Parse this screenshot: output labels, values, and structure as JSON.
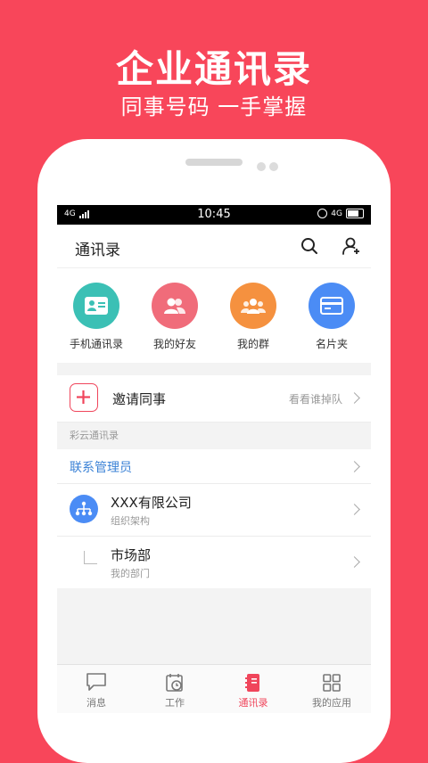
{
  "promo": {
    "title": "企业通讯录",
    "subtitle": "同事号码 一手掌握"
  },
  "status_bar": {
    "network_left": "4G",
    "time": "10:45",
    "network_right": "4G"
  },
  "header": {
    "title": "通讯录",
    "search_icon": "search-icon",
    "add_contact_icon": "add-person-icon"
  },
  "quick_actions": [
    {
      "label": "手机通讯录",
      "icon": "contact-card-icon",
      "color": "#3bc0b5"
    },
    {
      "label": "我的好友",
      "icon": "friends-icon",
      "color": "#f06c7a"
    },
    {
      "label": "我的群",
      "icon": "group-icon",
      "color": "#f5913f"
    },
    {
      "label": "名片夹",
      "icon": "business-card-icon",
      "color": "#4b8cf5"
    }
  ],
  "invite": {
    "label": "邀请同事",
    "hint": "看看谁掉队",
    "icon": "plus-icon",
    "accent": "#f0455b"
  },
  "section": {
    "title": "彩云通讯录"
  },
  "admin_link": {
    "label": "联系管理员",
    "color": "#3b82d6"
  },
  "org": {
    "name": "XXX有限公司",
    "sub": "组织架构",
    "icon": "org-chart-icon",
    "color": "#4b8cf5"
  },
  "dept": {
    "name": "市场部",
    "sub": "我的部门"
  },
  "tabs": [
    {
      "label": "消息",
      "icon": "message-icon",
      "active": false
    },
    {
      "label": "工作",
      "icon": "calendar-clock-icon",
      "active": false
    },
    {
      "label": "通讯录",
      "icon": "address-book-icon",
      "active": true
    },
    {
      "label": "我的应用",
      "icon": "apps-grid-icon",
      "active": false
    }
  ]
}
